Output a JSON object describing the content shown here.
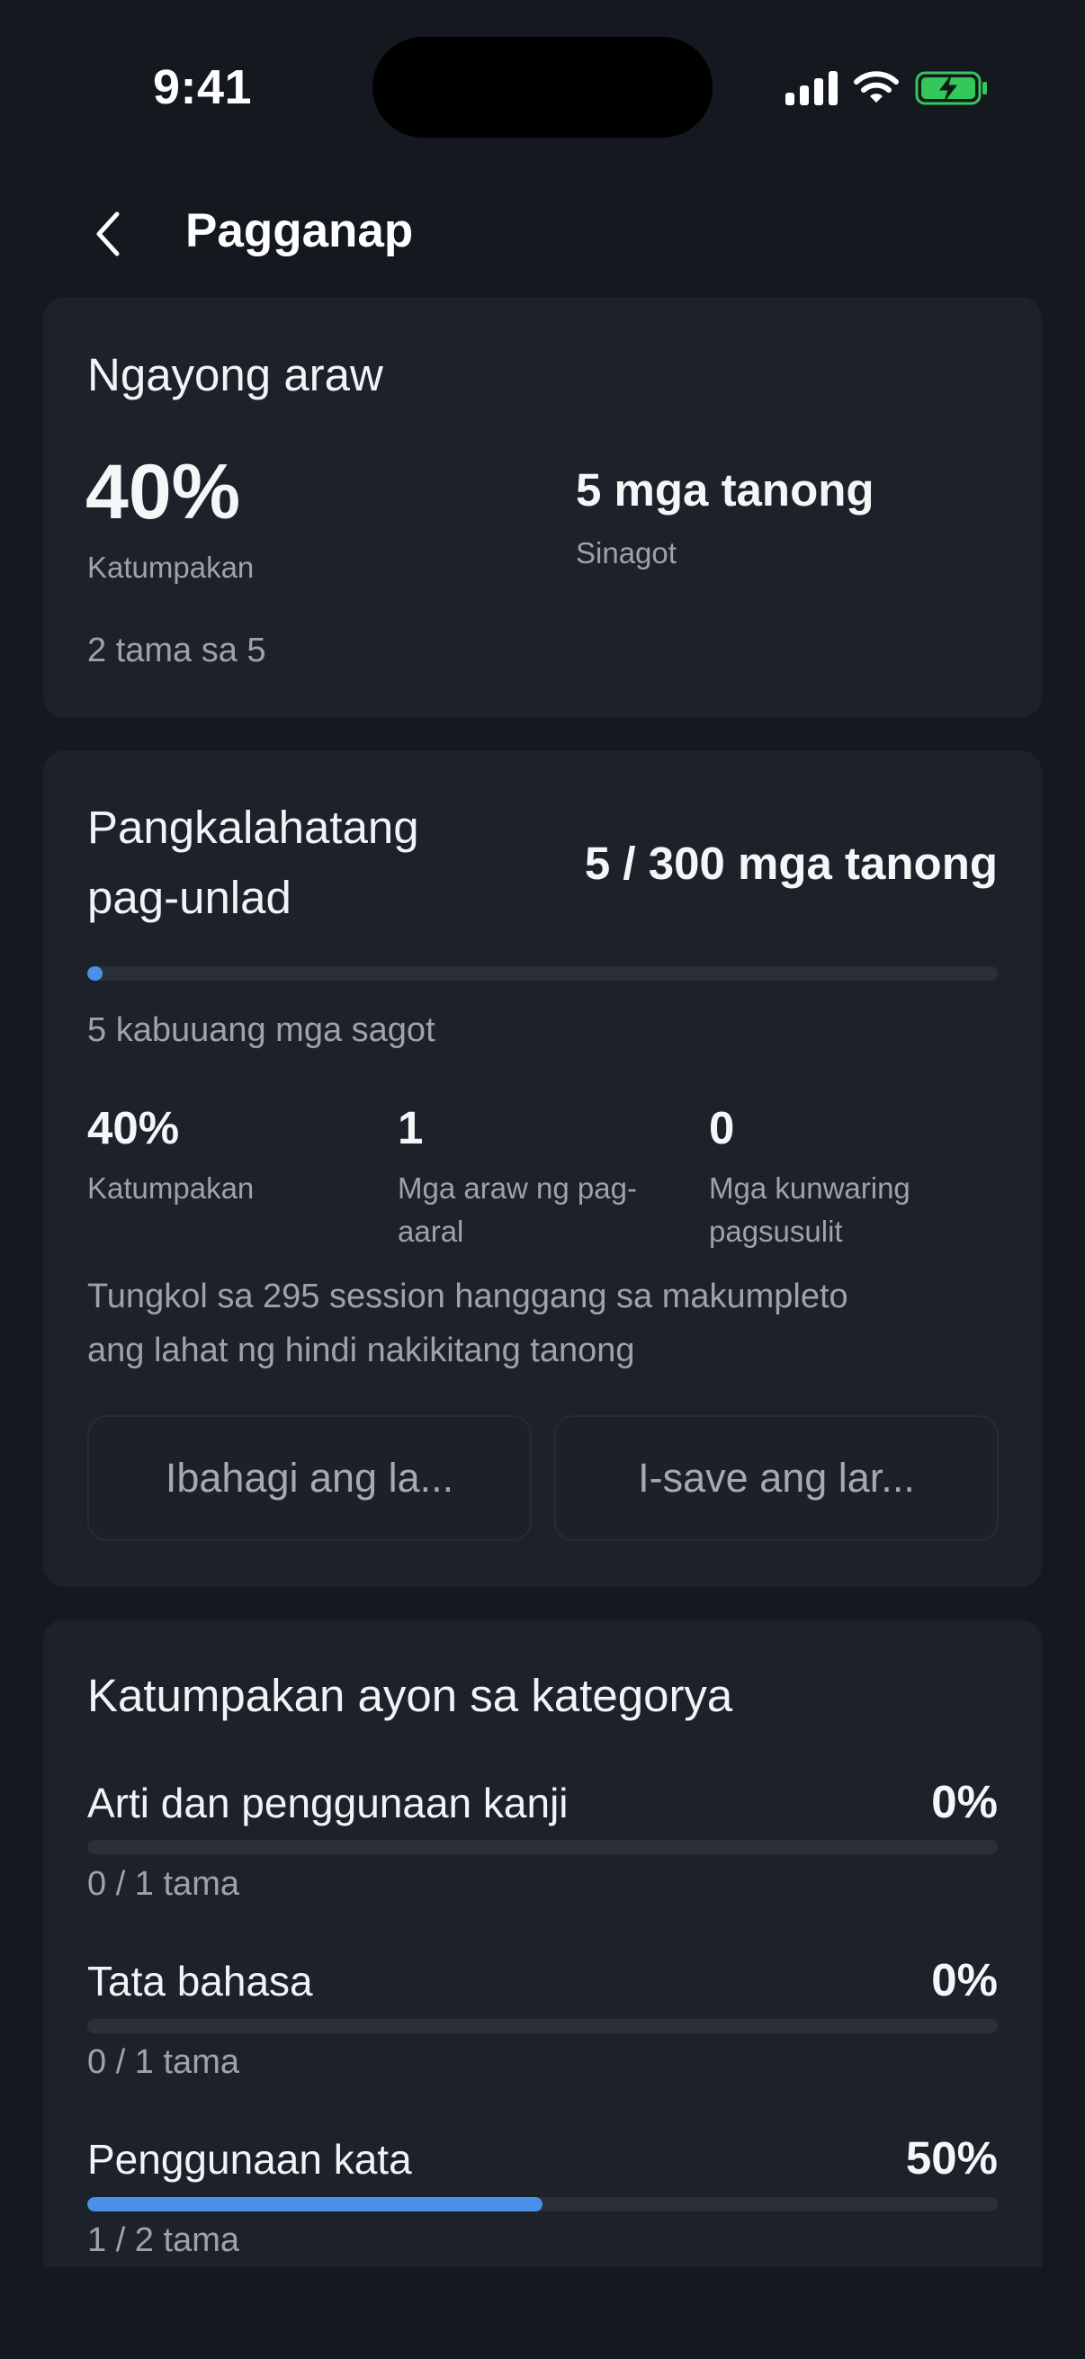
{
  "status_bar": {
    "time": "9:41",
    "icons": [
      "signal-icon",
      "wifi-icon",
      "battery-charging-icon"
    ]
  },
  "header": {
    "back_icon": "chevron-left-icon",
    "title": "Pagganap"
  },
  "today": {
    "heading": "Ngayong araw",
    "accuracy_value": "40%",
    "accuracy_label": "Katumpakan",
    "answered_value": "5 mga tanong",
    "answered_label": "Sinagot",
    "correct_summary": "2 tama sa 5"
  },
  "overall": {
    "heading_line1": "Pangkalahatang",
    "heading_line2": "pag-unlad",
    "progress_text": "5 / 300 mga tanong",
    "progress_fraction": 0.0167,
    "total_answers": "5 kabuuang mga sagot",
    "stats": [
      {
        "value": "40%",
        "label_line1": "Katumpakan",
        "label_line2": ""
      },
      {
        "value": "1",
        "label_line1": "Mga araw ng pag-",
        "label_line2": "aaral"
      },
      {
        "value": "0",
        "label_line1": "Mga kunwaring",
        "label_line2": "pagsusulit"
      }
    ],
    "estimate_line1": "Tungkol sa 295 session hanggang sa makumpleto",
    "estimate_line2": "ang lahat ng hindi nakikitang tanong",
    "share_button": "Ibahagi ang la...",
    "save_button": "I-save ang lar..."
  },
  "categories": {
    "heading": "Katumpakan ayon sa kategorya",
    "items": [
      {
        "name": "Arti dan penggunaan kanji",
        "percent": "0%",
        "fraction": 0,
        "sub": "0 / 1 tama"
      },
      {
        "name": "Tata bahasa",
        "percent": "0%",
        "fraction": 0,
        "sub": "0 / 1 tama"
      },
      {
        "name": "Penggunaan kata",
        "percent": "50%",
        "fraction": 0.5,
        "sub": "1 / 2 tama"
      }
    ]
  },
  "colors": {
    "background": "#14181f",
    "card": "#1d212a",
    "accent": "#4a90e8",
    "track": "#2a2f38",
    "muted_text": "#9ca3ae",
    "battery_green": "#34c759"
  }
}
